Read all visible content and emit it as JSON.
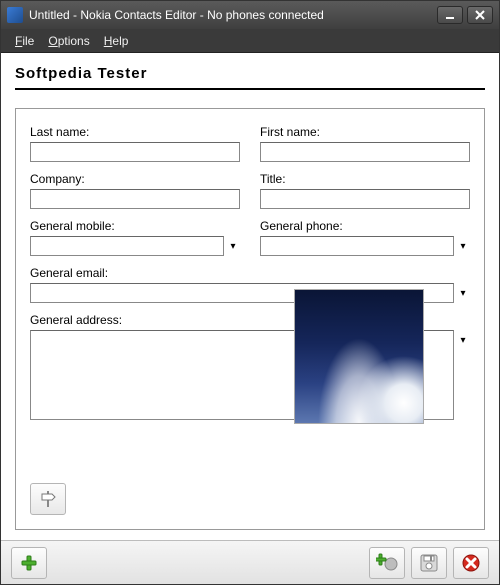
{
  "window": {
    "title": "Untitled - Nokia Contacts Editor - No phones connected"
  },
  "menubar": {
    "items": [
      "File",
      "Options",
      "Help"
    ]
  },
  "doc_title": "Softpedia  Tester",
  "form": {
    "last_name": {
      "label": "Last name:",
      "value": ""
    },
    "first_name": {
      "label": "First name:",
      "value": ""
    },
    "company": {
      "label": "Company:",
      "value": ""
    },
    "title": {
      "label": "Title:",
      "value": ""
    },
    "general_mobile": {
      "label": "General mobile:",
      "value": ""
    },
    "general_phone": {
      "label": "General phone:",
      "value": ""
    },
    "general_email": {
      "label": "General email:",
      "value": ""
    },
    "general_address": {
      "label": "General address:",
      "value": ""
    }
  },
  "icons": {
    "minimize": "minimize-icon",
    "close": "close-icon",
    "signpost": "signpost-icon",
    "add": "add-icon",
    "add_contact": "add-contact-icon",
    "save": "save-icon",
    "delete": "delete-icon"
  },
  "colors": {
    "accent_green": "#4caf2e",
    "accent_red": "#d42a1f"
  }
}
